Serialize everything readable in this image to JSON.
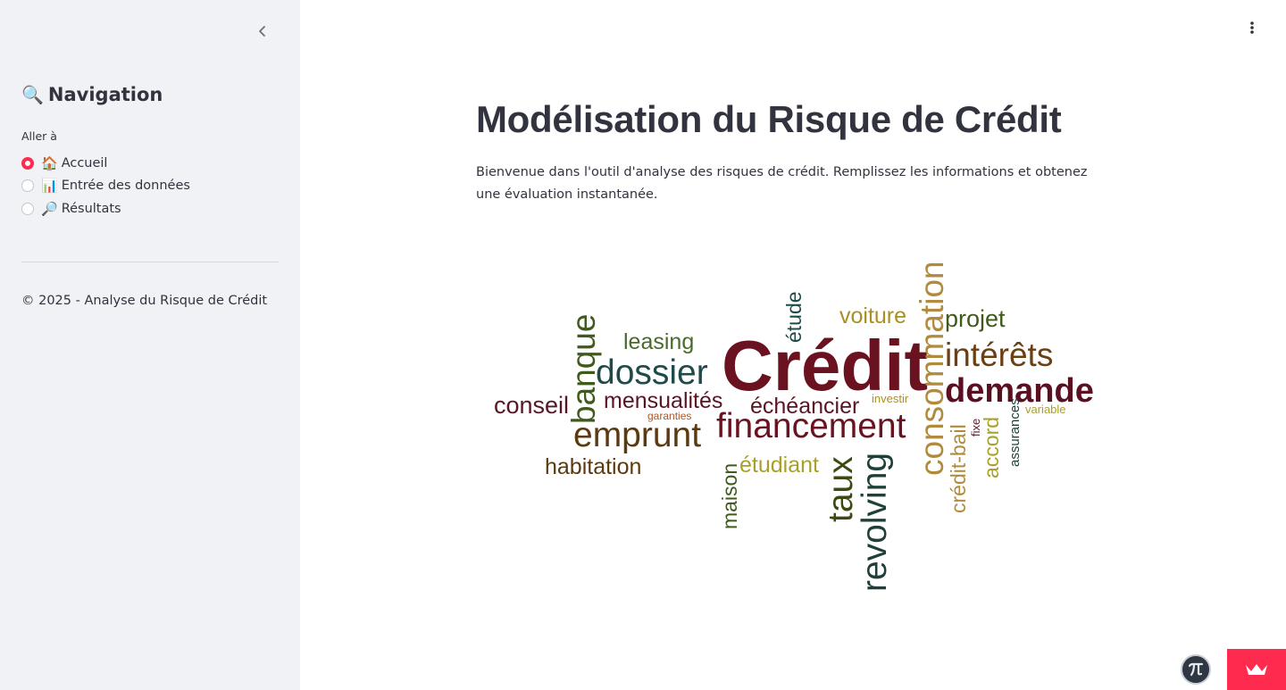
{
  "sidebar": {
    "title_emoji": "🔍",
    "title": "Navigation",
    "radio_label": "Aller à",
    "options": [
      {
        "emoji": "🏠",
        "label": "Accueil",
        "selected": true
      },
      {
        "emoji": "📊",
        "label": "Entrée des données",
        "selected": false
      },
      {
        "emoji": "🔎",
        "label": "Résultats",
        "selected": false
      }
    ],
    "footer": "© 2025 - Analyse du Risque de Crédit"
  },
  "main": {
    "title": "Modélisation du Risque de Crédit",
    "intro": "Bienvenue dans l'outil d'analyse des risques de crédit. Remplissez les informations et obtenez une évaluation instantanée."
  },
  "wordcloud": {
    "words": [
      {
        "text": "Crédit",
        "color": "#6b1220"
      },
      {
        "text": "consommation",
        "color": "#b08b3f"
      },
      {
        "text": "financement",
        "color": "#6b1220"
      },
      {
        "text": "demande",
        "color": "#5a1020"
      },
      {
        "text": "intérêts",
        "color": "#6b3f12"
      },
      {
        "text": "dossier",
        "color": "#1f4a4a"
      },
      {
        "text": "emprunt",
        "color": "#5c3a10"
      },
      {
        "text": "revolving",
        "color": "#1f3f3a"
      },
      {
        "text": "banque",
        "color": "#3f5a1a"
      },
      {
        "text": "taux",
        "color": "#3a4a10"
      },
      {
        "text": "mensualités",
        "color": "#5a1525"
      },
      {
        "text": "échéancier",
        "color": "#5a1525"
      },
      {
        "text": "conseil",
        "color": "#5a1525"
      },
      {
        "text": "habitation",
        "color": "#5c3a10"
      },
      {
        "text": "projet",
        "color": "#3f5a1a"
      },
      {
        "text": "voiture",
        "color": "#a89024"
      },
      {
        "text": "leasing",
        "color": "#4a6a2a"
      },
      {
        "text": "étudiant",
        "color": "#a8a02a"
      },
      {
        "text": "maison",
        "color": "#3f5a1a"
      },
      {
        "text": "étude",
        "color": "#1f4a4a"
      },
      {
        "text": "crédit-bail",
        "color": "#b08b3f"
      },
      {
        "text": "accord",
        "color": "#a8a02a"
      },
      {
        "text": "assurances",
        "color": "#1f3f3a"
      },
      {
        "text": "investir",
        "color": "#a8902a"
      },
      {
        "text": "garanties",
        "color": "#a8572a"
      },
      {
        "text": "variable",
        "color": "#a8a02a"
      },
      {
        "text": "fixe",
        "color": "#5a1525"
      }
    ]
  },
  "colors": {
    "accent": "#ff2b4f",
    "sidebar_bg": "#f0f2f6",
    "text": "#31333f"
  },
  "icons": {
    "collapse": "chevron-left-icon",
    "menu": "kebab-menu-icon",
    "avatar": "pi-avatar-icon",
    "deploy": "crown-icon"
  }
}
